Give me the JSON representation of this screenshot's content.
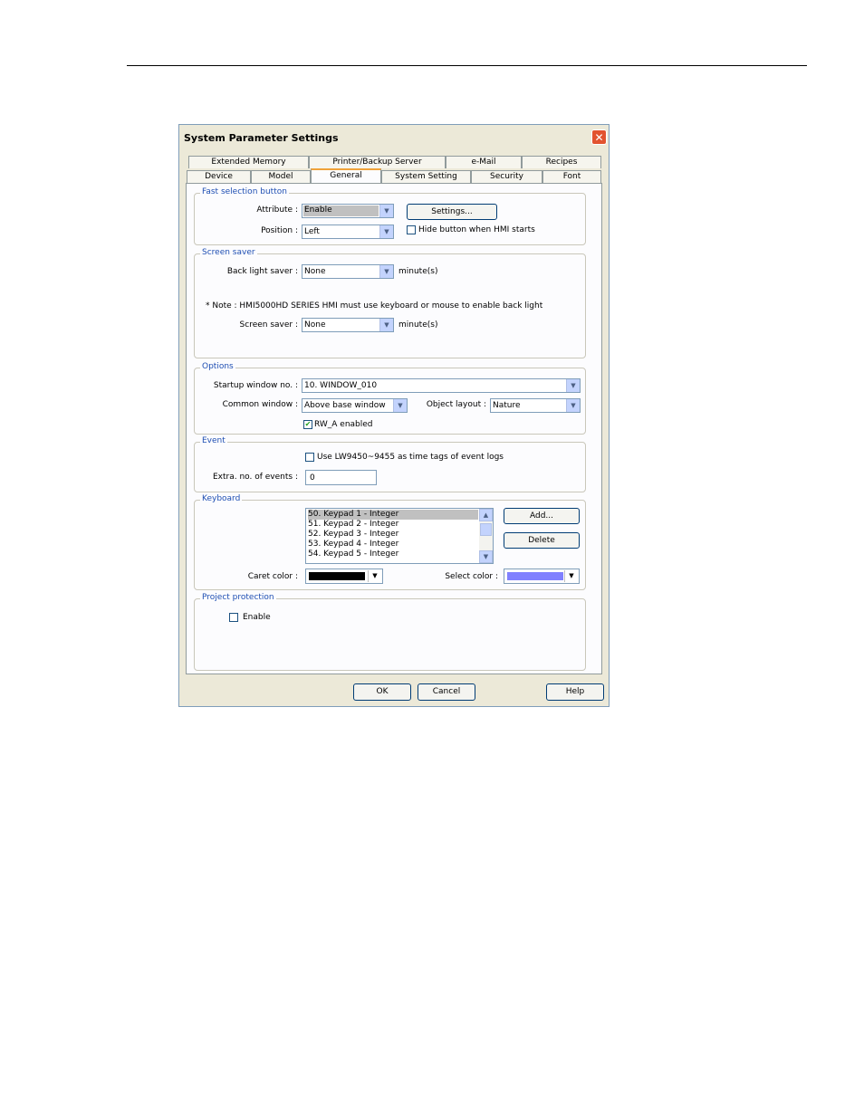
{
  "dialog": {
    "title": "System Parameter Settings",
    "close": "✕"
  },
  "tabs": {
    "row1": [
      "Extended Memory",
      "Printer/Backup Server",
      "e-Mail",
      "Recipes"
    ],
    "row2": [
      "Device",
      "Model",
      "General",
      "System Setting",
      "Security",
      "Font"
    ],
    "active": "General"
  },
  "fast_selection": {
    "group": "Fast selection button",
    "attribute_label": "Attribute :",
    "attribute_value": "Enable",
    "position_label": "Position :",
    "position_value": "Left",
    "settings_button": "Settings...",
    "hide_label": "Hide button when HMI starts",
    "hide_checked": false
  },
  "screen_saver": {
    "group": "Screen saver",
    "backlight_label": "Back light saver :",
    "backlight_value": "None",
    "backlight_unit": "minute(s)",
    "note": "* Note : HMI5000HD SERIES HMI must use keyboard or mouse to enable back light",
    "saver_label": "Screen saver :",
    "saver_value": "None",
    "saver_unit": "minute(s)"
  },
  "options": {
    "group": "Options",
    "startup_label": "Startup window no. :",
    "startup_value": "10. WINDOW_010",
    "common_label": "Common window :",
    "common_value": "Above base window",
    "layout_label": "Object layout :",
    "layout_value": "Nature",
    "rwa_label": "RW_A enabled",
    "rwa_checked": true
  },
  "event": {
    "group": "Event",
    "use_label": "Use LW9450~9455 as time tags of event logs",
    "use_checked": false,
    "extra_label": "Extra. no. of events :",
    "extra_value": "0"
  },
  "keyboard": {
    "group": "Keyboard",
    "items": [
      "50. Keypad 1 - Integer",
      "51. Keypad 2 - Integer",
      "52. Keypad 3 - Integer",
      "53. Keypad 4 - Integer",
      "54. Keypad 5 - Integer"
    ],
    "add_button": "Add...",
    "delete_button": "Delete",
    "caret_label": "Caret color :",
    "caret_color": "#000000",
    "select_label": "Select color :",
    "select_color": "#8080ff"
  },
  "project_protection": {
    "group": "Project protection",
    "enable_label": "Enable",
    "enable_checked": false
  },
  "footer": {
    "ok": "OK",
    "cancel": "Cancel",
    "help": "Help"
  }
}
